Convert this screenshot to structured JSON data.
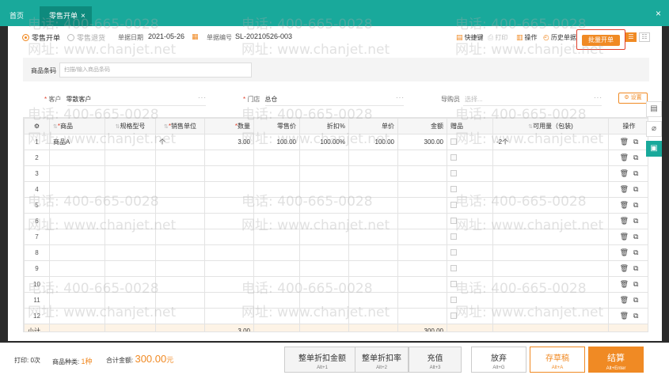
{
  "tabs": {
    "home": "首页",
    "active": "零售开单",
    "active_close": "×",
    "window_close": "×"
  },
  "header": {
    "mode_sale": "零售开单",
    "mode_return": "零售退货",
    "date_label": "单据日期",
    "date_value": "2021-05-26",
    "number_label": "单据编号",
    "number_value": "SL-20210526-003",
    "actions": {
      "shortcut": "快捷键",
      "print": "打印",
      "operate": "操作",
      "history": "历史单据"
    },
    "batch_button": "批量开单"
  },
  "barcode": {
    "label": "商品条码",
    "placeholder": "扫描/输入商品条码"
  },
  "form": {
    "customer_label": "客户",
    "customer_value": "零散客户",
    "store_label": "门店",
    "store_value": "总仓",
    "guide_label": "导购员",
    "guide_placeholder": "选择...",
    "settings_button": "设置"
  },
  "table": {
    "headers": [
      "商品",
      "规格型号",
      "销售单位",
      "数量",
      "零售价",
      "折扣%",
      "单价",
      "金额",
      "赠品",
      "可用量（包装)",
      "操作"
    ],
    "rows": [
      {
        "idx": "1",
        "product": "商品A",
        "spec": "",
        "unit": "个",
        "qty": "3.00",
        "retail": "100.00",
        "discount": "100.00%",
        "price": "100.00",
        "amount": "300.00",
        "avail": "-2个"
      },
      {
        "idx": "2"
      },
      {
        "idx": "3"
      },
      {
        "idx": "4"
      },
      {
        "idx": "5"
      },
      {
        "idx": "6"
      },
      {
        "idx": "7"
      },
      {
        "idx": "8"
      },
      {
        "idx": "9"
      },
      {
        "idx": "10"
      },
      {
        "idx": "11"
      },
      {
        "idx": "12"
      }
    ],
    "summary": {
      "label": "小计",
      "qty": "3.00",
      "amount": "300.00"
    }
  },
  "footer": {
    "print_label": "打印:",
    "print_count": "0次",
    "kinds_label": "商品种类:",
    "kinds_value": "1种",
    "total_label": "合计金额:",
    "total_value": "300.00",
    "total_unit": "元",
    "buttons": [
      {
        "label": "整单折扣金额",
        "key": "Alt+1"
      },
      {
        "label": "整单折扣率",
        "key": "Alt+2"
      },
      {
        "label": "充值",
        "key": "Alt+3"
      },
      {
        "label": "放弃",
        "key": "Alt+G"
      },
      {
        "label": "存草稿",
        "key": "Alt+A"
      },
      {
        "label": "结算",
        "key": "Alt+Enter"
      }
    ]
  },
  "watermark": {
    "phone": "电话: 400-665-0028",
    "site": "网址: www.chanjet.net"
  },
  "colors": {
    "teal": "#19a99b",
    "orange": "#f08a24",
    "red": "#e0402c"
  }
}
